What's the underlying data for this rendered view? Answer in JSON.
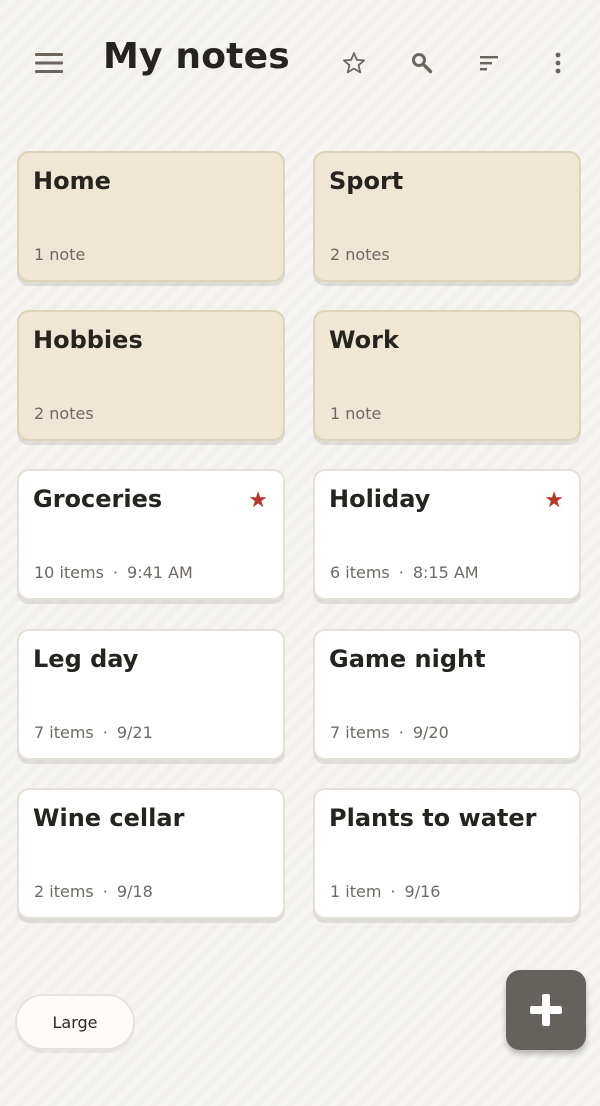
{
  "header": {
    "title": "My notes",
    "menu_icon": "hamburger-menu-icon",
    "favorites_icon": "star-outline-icon",
    "search_icon": "search-icon",
    "sort_icon": "sort-icon",
    "more_icon": "more-vertical-icon"
  },
  "folders": [
    {
      "name": "Home",
      "count": "1 note"
    },
    {
      "name": "Sport",
      "count": "2 notes"
    },
    {
      "name": "Hobbies",
      "count": "2 notes"
    },
    {
      "name": "Work",
      "count": "1 note"
    }
  ],
  "lists": [
    {
      "name": "Groceries",
      "items": "10 items",
      "date": "9:41 AM",
      "starred": true
    },
    {
      "name": "Holiday",
      "items": "6 items",
      "date": "8:15 AM",
      "starred": true
    },
    {
      "name": "Leg day",
      "items": "7 items",
      "date": "9/21",
      "starred": false
    },
    {
      "name": "Game night",
      "items": "7 items",
      "date": "9/20",
      "starred": false
    },
    {
      "name": "Wine cellar",
      "items": "2 items",
      "date": "9/18",
      "starred": false
    },
    {
      "name": "Plants to water",
      "items": "1 item",
      "date": "9/16",
      "starred": false
    }
  ],
  "meta_separator": "·",
  "star_glyph": "★",
  "size_toggle": {
    "label": "Large"
  },
  "fab_icon": "plus-icon",
  "colors": {
    "folder_bg": "#efe6d4",
    "card_bg": "#ffffff",
    "star": "#b8352c",
    "fab": "#65615c",
    "icon": "#6b655e"
  }
}
